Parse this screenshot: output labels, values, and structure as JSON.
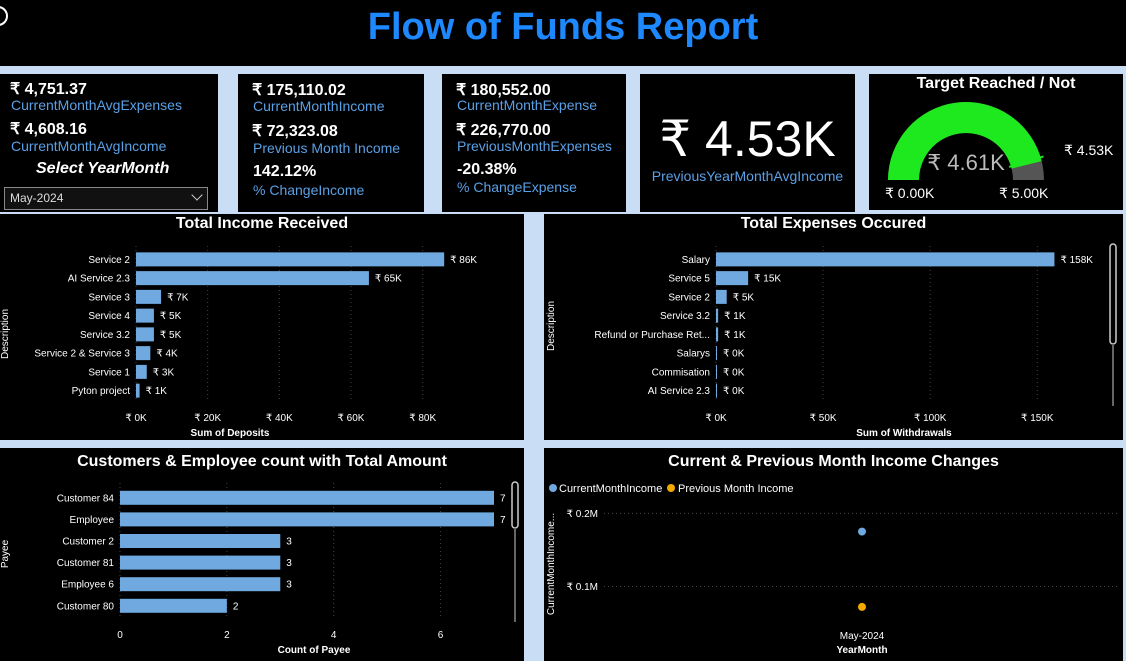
{
  "header": {
    "title": "Flow of Funds Report"
  },
  "card1": {
    "avg_expenses_value": "₹ 4,751.37",
    "avg_expenses_label": "CurrentMonthAvgExpenses",
    "avg_income_value": "₹ 4,608.16",
    "avg_income_label": "CurrentMonthAvgIncome",
    "select_label": "Select YearMonth",
    "select_value": "May-2024"
  },
  "card2": {
    "income_value": "₹ 175,110.02",
    "income_label": "CurrentMonthIncome",
    "prev_income_value": "₹ 72,323.08",
    "prev_income_label": "Previous Month Income",
    "change_value": "142.12%",
    "change_label": "% ChangeIncome"
  },
  "card3": {
    "expense_value": "₹ 180,552.00",
    "expense_label": "CurrentMonthExpense",
    "prev_expense_value": "₹ 226,770.00",
    "prev_expense_label": "PreviousMonthExpenses",
    "change_value": "-20.38%",
    "change_label": "% ChangeExpense"
  },
  "card4": {
    "value": "₹ 4.53K",
    "label": "PreviousYearMonthAvgIncome"
  },
  "colors": {
    "bar": "#6fa9e0",
    "gauge": "#1ee81e",
    "prev": "#f2a900",
    "title": "#1e88ff"
  },
  "chart_data": [
    {
      "type": "gauge",
      "title": "Target Reached / Not",
      "value": 4.61,
      "value_label": "₹ 4.61K",
      "target": 4.53,
      "target_label": "₹ 4.53K",
      "min": 0,
      "max": 5.0,
      "min_label": "₹ 0.00K",
      "max_label": "₹ 5.00K"
    },
    {
      "type": "bar",
      "orientation": "horizontal",
      "title": "Total Income Received",
      "xlabel": "Sum of Deposits",
      "ylabel": "Description",
      "categories": [
        "Service 2",
        "AI Service 2.3",
        "Service 3",
        "Service 4",
        "Service 3.2",
        "Service 2 & Service 3",
        "Service 1",
        "Pyton project"
      ],
      "values": [
        86,
        65,
        7,
        5,
        5,
        4,
        3,
        1
      ],
      "data_labels": [
        "₹ 86K",
        "₹ 65K",
        "₹ 7K",
        "₹ 5K",
        "₹ 5K",
        "₹ 4K",
        "₹ 3K",
        "₹ 1K"
      ],
      "xlim": [
        0,
        96
      ],
      "xticks": [
        0,
        20,
        40,
        60,
        80
      ],
      "xtick_labels": [
        "₹ 0K",
        "₹ 20K",
        "₹ 40K",
        "₹ 60K",
        "₹ 80K"
      ]
    },
    {
      "type": "bar",
      "orientation": "horizontal",
      "title": "Total Expenses Occured",
      "xlabel": "Sum of Withdrawals",
      "ylabel": "Description",
      "categories": [
        "Salary",
        "Service 5",
        "Service 2",
        "Service 3.2",
        "Refund or Purchase Ret...",
        "Salarys",
        "Commisation",
        "AI Service 2.3"
      ],
      "values": [
        158,
        15,
        5,
        1,
        1,
        0.3,
        0.3,
        0.3
      ],
      "data_labels": [
        "₹ 158K",
        "₹ 15K",
        "₹ 5K",
        "₹ 1K",
        "₹ 1K",
        "₹ 0K",
        "₹ 0K",
        "₹ 0K"
      ],
      "xlim": [
        0,
        169
      ],
      "xticks": [
        0,
        50,
        100,
        150
      ],
      "xtick_labels": [
        "₹ 0K",
        "₹ 50K",
        "₹ 100K",
        "₹ 150K"
      ]
    },
    {
      "type": "bar",
      "orientation": "horizontal",
      "title": "Customers & Employee count with Total Amount",
      "xlabel": "Count of Payee",
      "ylabel": "Payee",
      "categories": [
        "Customer 84",
        "Employee",
        "Customer 2",
        "Customer 81",
        "Employee 6",
        "Customer 80"
      ],
      "values": [
        7,
        7,
        3,
        3,
        3,
        2
      ],
      "data_labels": [
        "7",
        "7",
        "3",
        "3",
        "3",
        "2"
      ],
      "xlim": [
        0,
        7
      ],
      "xticks": [
        0,
        2,
        4,
        6
      ],
      "xtick_labels": [
        "0",
        "2",
        "4",
        "6"
      ]
    },
    {
      "type": "scatter",
      "title": "Current & Previous Month Income Changes",
      "xlabel": "YearMonth",
      "ylabel": "CurrentMonthIncome...",
      "categories": [
        "May-2024"
      ],
      "series": [
        {
          "name": "CurrentMonthIncome",
          "values": [
            0.175
          ]
        },
        {
          "name": "Previous Month Income",
          "values": [
            0.072
          ]
        }
      ],
      "yticks": [
        0.1,
        0.2
      ],
      "ytick_labels": [
        "₹ 0.1M",
        "₹ 0.2M"
      ],
      "ylim": [
        0.05,
        0.21
      ]
    }
  ]
}
